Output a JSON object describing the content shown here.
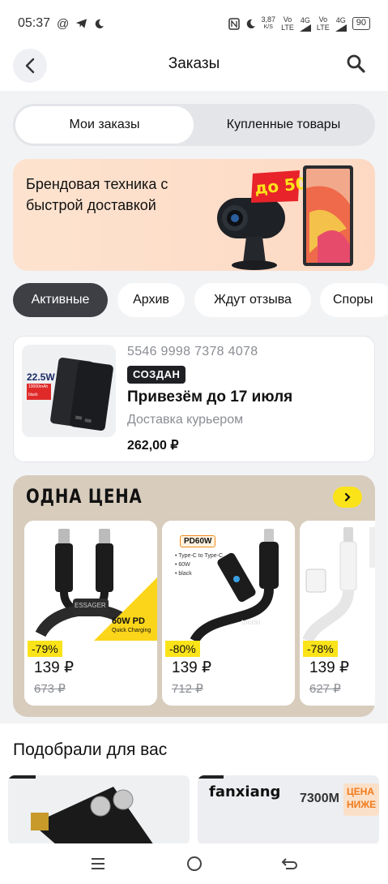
{
  "status_bar": {
    "time": "05:37",
    "net_speed_top": "3,87",
    "net_speed_bottom": "K/S",
    "sim1_top": "Vo",
    "sim1_bottom": "LTE",
    "sim1_net": "4G",
    "sim2_top": "Vo",
    "sim2_bottom": "LTE",
    "sim2_net": "4G",
    "battery": "90"
  },
  "header": {
    "title": "Заказы"
  },
  "segments": {
    "my_orders": "Мои заказы",
    "purchased": "Купленные товары"
  },
  "promo": {
    "text": "Брендовая техника с быстрой доставкой",
    "badge": "до 50%"
  },
  "filters": [
    "Активные",
    "Архив",
    "Ждут отзыва",
    "Споры"
  ],
  "order": {
    "number": "5546 9998 7378 4078",
    "status": "СОЗДАН",
    "eta": "Привезём до 17 июля",
    "delivery": "Доставка курьером",
    "price": "262,00 ₽",
    "thumb_label_watt": "22.5W",
    "thumb_label_mah": "10000mAh",
    "thumb_label_color": "black"
  },
  "one_price": {
    "title": "ОДНА ЦЕНА",
    "arrow": "›",
    "products": [
      {
        "discount": "-79%",
        "price": "139 ₽",
        "old_price": "673 ₽",
        "brand": "ESSAGER",
        "tag": "60W PD",
        "tag_sub": "Quick Charging"
      },
      {
        "discount": "-80%",
        "price": "139 ₽",
        "old_price": "712 ₽",
        "brand": "toocki",
        "tag": "PD60W",
        "bullets": [
          "• Type-C to Type-C",
          "• 60W",
          "• black"
        ]
      },
      {
        "discount": "-78%",
        "price": "139 ₽",
        "old_price": "627 ₽"
      }
    ]
  },
  "suggest": {
    "title": "Подобрали для вас",
    "card2_brand": "fanxiang",
    "card2_model": "7300M",
    "card2_badge_top": "ЦЕНА",
    "card2_badge_bottom": "НИЖЕ"
  },
  "colors": {
    "accent_yellow": "#fbe31a",
    "promo_bg": "#fde3cf",
    "one_price_bg": "#d8ccbd",
    "chip_active": "#3d3f45",
    "promo_badge": "#e8232a"
  }
}
